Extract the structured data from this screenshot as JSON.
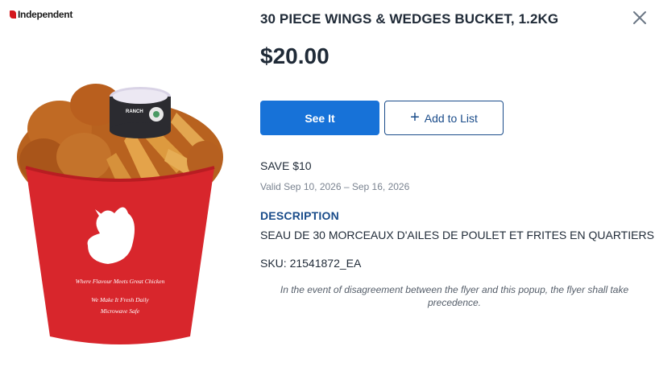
{
  "brand": {
    "logo_text": "Independent"
  },
  "product": {
    "title": "30 PIECE WINGS & WEDGES BUCKET, 1.2KG",
    "price": "$20.00",
    "save": "SAVE $10",
    "valid": "Valid Sep 10, 2026 – Sep 16, 2026",
    "description_heading": "DESCRIPTION",
    "description": "SEAU DE 30 MORCEAUX D'AILES DE POULET ET FRITES EN QUARTIERS",
    "sku": "SKU: 21541872_EA",
    "image_icon": "chicken-bucket-photo",
    "bucket_text_1": "Where Flavour Meets Great Chicken",
    "bucket_text_2": "We Make It Fresh Daily",
    "bucket_text_3": "Microwave Safe",
    "dip_label": "RANCH"
  },
  "actions": {
    "see_it_label": "See It",
    "add_to_list_label": "Add to List",
    "add_icon": "plus-icon",
    "close_icon": "close-icon"
  },
  "disclaimer": "In the event of disagreement between the flyer and this popup, the flyer shall take precedence.",
  "colors": {
    "primary": "#1772d8",
    "heading_blue": "#1a4c8a",
    "text": "#1f2a37",
    "muted": "#7a8390",
    "bucket_red": "#d8262c",
    "brand_red": "#d4161c"
  }
}
